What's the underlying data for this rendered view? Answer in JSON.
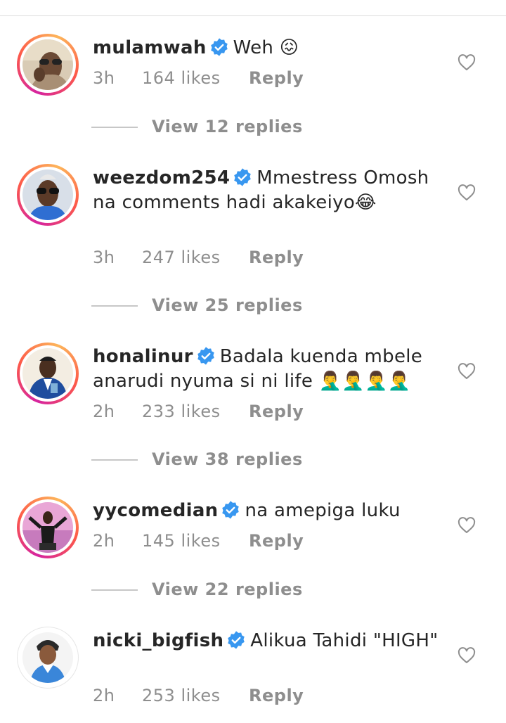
{
  "comments": [
    {
      "username": "mulamwah",
      "text": "Weh 😖",
      "time": "3h",
      "likes": "164 likes",
      "reply_label": "Reply",
      "view_replies": "View 12 replies",
      "avatar_icon": "avatar-photo-man-sunglasses"
    },
    {
      "username": "weezdom254",
      "text": "Mmestress Omosh na comments hadi akakeiyo😂",
      "time": "3h",
      "likes": "247 likes",
      "reply_label": "Reply",
      "view_replies": "View 25 replies",
      "avatar_icon": "avatar-photo-man-sunglasses-blue"
    },
    {
      "username": "honalinur",
      "text": "Badala kuenda mbele anarudi nyuma si ni life 🤦‍♂️🤦‍♂️🤦‍♂️🤦‍♂️",
      "time": "2h",
      "likes": "233 likes",
      "reply_label": "Reply",
      "view_replies": "View 38 replies",
      "avatar_icon": "avatar-photo-man-suit"
    },
    {
      "username": "yycomedian",
      "text": "na amepiga luku",
      "time": "2h",
      "likes": "145 likes",
      "reply_label": "Reply",
      "view_replies": "View 22 replies",
      "avatar_icon": "avatar-photo-man-pink"
    },
    {
      "username": "nicki_bigfish",
      "text": "Alikua Tahidi \"HIGH\"",
      "time": "2h",
      "likes": "253 likes",
      "reply_label": "Reply",
      "avatar_icon": "avatar-photo-man-cartoon"
    }
  ],
  "colors": {
    "verified": "#3897f0",
    "secondary_text": "#8e8e8e",
    "primary_text": "#262626"
  }
}
